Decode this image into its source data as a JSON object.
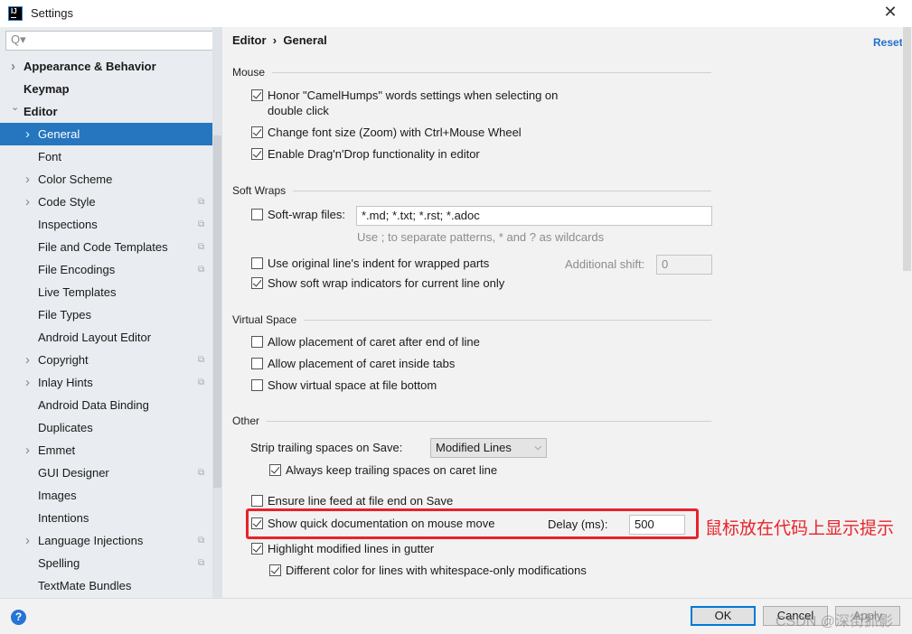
{
  "window": {
    "title": "Settings",
    "close": "✕"
  },
  "search": {
    "placeholder": "Q▾"
  },
  "sidebar": {
    "items": [
      {
        "label": "Appearance & Behavior",
        "level": 0,
        "bold": true,
        "chevron": "›"
      },
      {
        "label": "Keymap",
        "level": 0,
        "bold": true,
        "chevron": ""
      },
      {
        "label": "Editor",
        "level": 0,
        "bold": true,
        "chevron": "⌄"
      },
      {
        "label": "General",
        "level": 1,
        "chevron": "›",
        "selected": true
      },
      {
        "label": "Font",
        "level": 1,
        "chevron": ""
      },
      {
        "label": "Color Scheme",
        "level": 1,
        "chevron": "›"
      },
      {
        "label": "Code Style",
        "level": 1,
        "chevron": "›",
        "copy": true
      },
      {
        "label": "Inspections",
        "level": 1,
        "chevron": "",
        "copy": true
      },
      {
        "label": "File and Code Templates",
        "level": 1,
        "chevron": "",
        "copy": true
      },
      {
        "label": "File Encodings",
        "level": 1,
        "chevron": "",
        "copy": true
      },
      {
        "label": "Live Templates",
        "level": 1,
        "chevron": ""
      },
      {
        "label": "File Types",
        "level": 1,
        "chevron": ""
      },
      {
        "label": "Android Layout Editor",
        "level": 1,
        "chevron": ""
      },
      {
        "label": "Copyright",
        "level": 1,
        "chevron": "›",
        "copy": true
      },
      {
        "label": "Inlay Hints",
        "level": 1,
        "chevron": "›",
        "copy": true
      },
      {
        "label": "Android Data Binding",
        "level": 1,
        "chevron": ""
      },
      {
        "label": "Duplicates",
        "level": 1,
        "chevron": ""
      },
      {
        "label": "Emmet",
        "level": 1,
        "chevron": "›"
      },
      {
        "label": "GUI Designer",
        "level": 1,
        "chevron": "",
        "copy": true
      },
      {
        "label": "Images",
        "level": 1,
        "chevron": ""
      },
      {
        "label": "Intentions",
        "level": 1,
        "chevron": ""
      },
      {
        "label": "Language Injections",
        "level": 1,
        "chevron": "›",
        "copy": true
      },
      {
        "label": "Spelling",
        "level": 1,
        "chevron": "",
        "copy": true
      },
      {
        "label": "TextMate Bundles",
        "level": 1,
        "chevron": ""
      }
    ]
  },
  "header": {
    "crumb1": "Editor",
    "sep": "›",
    "crumb2": "General",
    "reset": "Reset"
  },
  "mouse": {
    "title": "Mouse",
    "camel": "Honor \"CamelHumps\" words settings when selecting on",
    "camel2": "double click",
    "zoom": "Change font size (Zoom) with Ctrl+Mouse Wheel",
    "dnd": "Enable Drag'n'Drop functionality in editor"
  },
  "softwraps": {
    "title": "Soft Wraps",
    "files_label": "Soft-wrap files:",
    "files_value": "*.md; *.txt; *.rst; *.adoc",
    "hint": "Use ; to separate patterns, * and ? as wildcards",
    "indent": "Use original line's indent for wrapped parts",
    "shift_label": "Additional shift:",
    "shift_value": "0",
    "indicators": "Show soft wrap indicators for current line only"
  },
  "virtual": {
    "title": "Virtual Space",
    "after_end": "Allow placement of caret after end of line",
    "inside_tabs": "Allow placement of caret inside tabs",
    "file_bottom": "Show virtual space at file bottom"
  },
  "other": {
    "title": "Other",
    "strip_label": "Strip trailing spaces on Save:",
    "strip_value": "Modified Lines",
    "keep_trailing": "Always keep trailing spaces on caret line",
    "line_feed": "Ensure line feed at file end on Save",
    "quick_doc": "Show quick documentation on mouse move",
    "delay_label": "Delay (ms):",
    "delay_value": "500",
    "highlight": "Highlight modified lines in gutter",
    "whitespace": "Different color for lines with whitespace-only modifications"
  },
  "annotation": {
    "text": "鼠标放在代码上显示提示",
    "color": "#e8232a"
  },
  "footer": {
    "help": "?",
    "ok": "OK",
    "cancel": "Cancel",
    "apply": "Apply",
    "watermark": "CSDN @深街抓影"
  },
  "colors": {
    "accent": "#2675bf",
    "link": "#2470c9"
  }
}
